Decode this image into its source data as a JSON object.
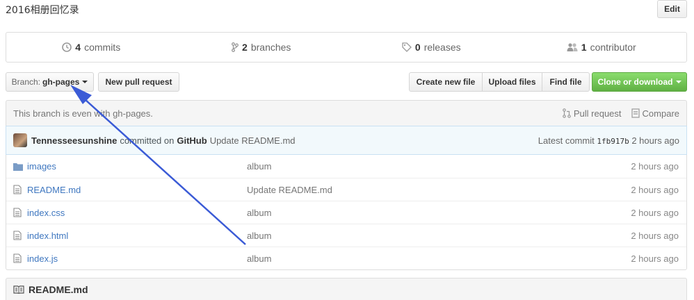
{
  "repo": {
    "description": "2016相册回忆录",
    "edit_label": "Edit"
  },
  "summary": {
    "commits": {
      "count": "4",
      "label": "commits",
      "icon": "history-icon"
    },
    "branches": {
      "count": "2",
      "label": "branches",
      "icon": "branch-icon"
    },
    "releases": {
      "count": "0",
      "label": "releases",
      "icon": "tag-icon"
    },
    "contributors": {
      "count": "1",
      "label": "contributor",
      "icon": "people-icon"
    }
  },
  "toolbar": {
    "branch_prefix": "Branch:",
    "branch_name": "gh-pages",
    "new_pr": "New pull request",
    "create_file": "Create new file",
    "upload_files": "Upload files",
    "find_file": "Find file",
    "clone": "Clone or download"
  },
  "compare": {
    "status": "This branch is even with gh-pages.",
    "pull_request": "Pull request",
    "compare": "Compare"
  },
  "commit": {
    "author": "Tennesseesunshine",
    "action": "committed on",
    "committer": "GitHub",
    "message": "Update README.md",
    "latest_label": "Latest commit",
    "sha": "1fb917b",
    "age": "2 hours ago"
  },
  "files": [
    {
      "type": "folder",
      "name": "images",
      "message": "album",
      "age": "2 hours ago"
    },
    {
      "type": "file",
      "name": "README.md",
      "message": "Update README.md",
      "age": "2 hours ago"
    },
    {
      "type": "file",
      "name": "index.css",
      "message": "album",
      "age": "2 hours ago"
    },
    {
      "type": "file",
      "name": "index.html",
      "message": "album",
      "age": "2 hours ago"
    },
    {
      "type": "file",
      "name": "index.js",
      "message": "album",
      "age": "2 hours ago"
    }
  ],
  "readme": {
    "title": "README.md",
    "icon": "book-icon"
  },
  "colors": {
    "link": "#4078c0",
    "clone_green": "#60b044",
    "annotation_arrow": "#3b5bd6"
  }
}
